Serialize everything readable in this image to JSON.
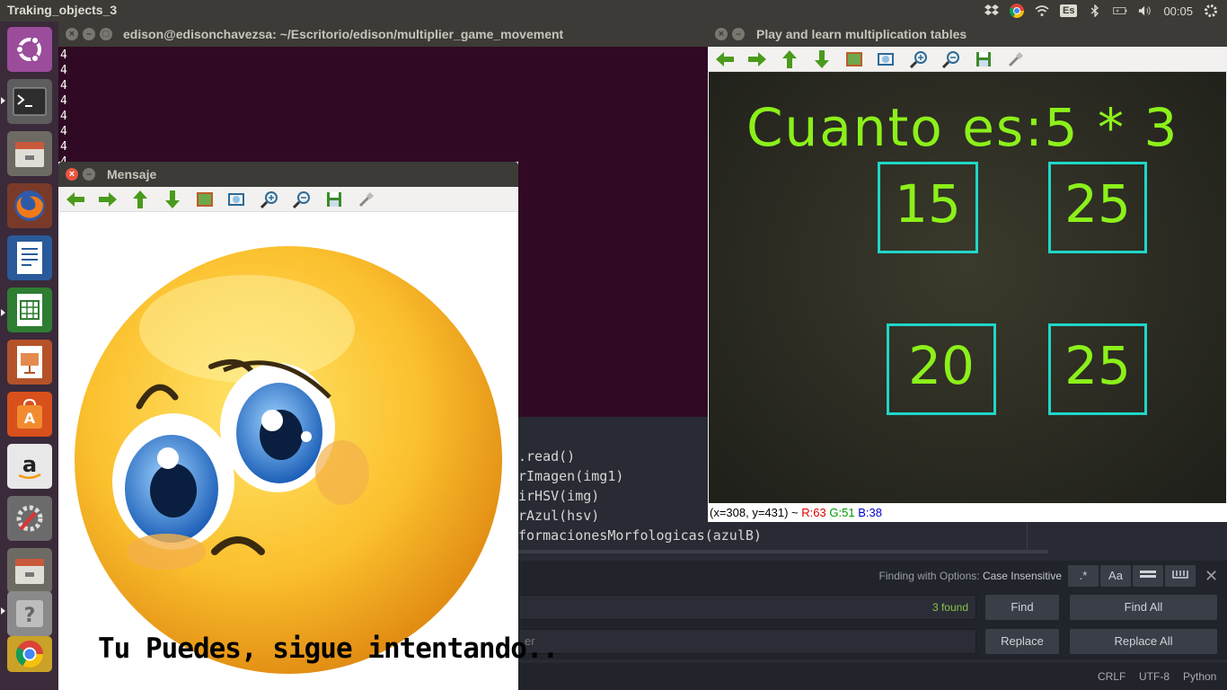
{
  "topbar": {
    "app_title": "Traking_objects_3",
    "keyboard": "Es",
    "time": "00:05"
  },
  "launcher": {
    "items": [
      "ubuntu-dash",
      "terminal",
      "files",
      "firefox",
      "writer",
      "calc",
      "impress",
      "software-center",
      "amazon",
      "system-settings",
      "files-2",
      "help",
      "chrome"
    ]
  },
  "terminal": {
    "title": "edison@edisonchavezsa: ~/Escritorio/edison/multiplier_game_movement",
    "lines": [
      "4",
      "4",
      "4",
      "4",
      "4",
      "4",
      "4",
      "4"
    ]
  },
  "editor": {
    "code_lines": [
      ".read()",
      "rImagen(img1)",
      "irHSV(img)",
      "rAzul(hsv)",
      "formacionesMorfologicas(azulB)"
    ],
    "find": {
      "options_label": "Finding with Options:",
      "options_value": "Case Insensitive",
      "opt_regex": ".*",
      "opt_case": "Aa",
      "found_count": "3 found",
      "replace_placeholder": "er",
      "find_label": "Find",
      "find_all_label": "Find All",
      "replace_label": "Replace",
      "replace_all_label": "Replace All"
    },
    "status": {
      "line_endings": "CRLF",
      "encoding": "UTF-8",
      "language": "Python"
    }
  },
  "mensaje": {
    "title": "Mensaje",
    "caption": "Tu Puedes, sigue intentando.."
  },
  "play": {
    "title": "Play and learn multiplication tables",
    "question": "Cuanto es:5 * 3",
    "answers": [
      "15",
      "25",
      "20",
      "25"
    ],
    "status": {
      "coords": "(x=308, y=431) ~",
      "r": "R:63",
      "g": "G:51",
      "b": "B:38"
    }
  },
  "colors": {
    "answer_box": "#1fd6c8",
    "text_green": "#8cf01a"
  }
}
